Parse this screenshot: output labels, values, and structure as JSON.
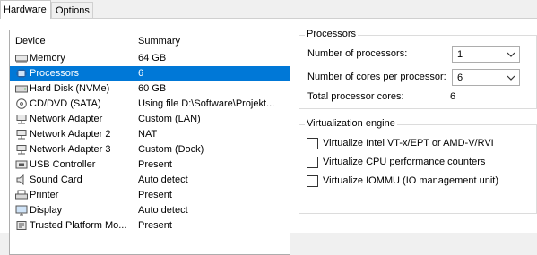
{
  "tabs": [
    {
      "label": "Hardware",
      "active": true
    },
    {
      "label": "Options",
      "active": false
    }
  ],
  "device_list": {
    "columns": [
      "Device",
      "Summary"
    ],
    "rows": [
      {
        "icon": "memory-icon",
        "device": "Memory",
        "summary": "64 GB",
        "selected": false
      },
      {
        "icon": "processor-icon",
        "device": "Processors",
        "summary": "6",
        "selected": true
      },
      {
        "icon": "hard-disk-icon",
        "device": "Hard Disk (NVMe)",
        "summary": "60 GB",
        "selected": false
      },
      {
        "icon": "cd-dvd-icon",
        "device": "CD/DVD (SATA)",
        "summary": "Using file D:\\Software\\Projekt...",
        "selected": false
      },
      {
        "icon": "network-adapter-icon",
        "device": "Network Adapter",
        "summary": "Custom (LAN)",
        "selected": false
      },
      {
        "icon": "network-adapter-icon",
        "device": "Network Adapter 2",
        "summary": "NAT",
        "selected": false
      },
      {
        "icon": "network-adapter-icon",
        "device": "Network Adapter 3",
        "summary": "Custom (Dock)",
        "selected": false
      },
      {
        "icon": "usb-controller-icon",
        "device": "USB Controller",
        "summary": "Present",
        "selected": false
      },
      {
        "icon": "sound-card-icon",
        "device": "Sound Card",
        "summary": "Auto detect",
        "selected": false
      },
      {
        "icon": "printer-icon",
        "device": "Printer",
        "summary": "Present",
        "selected": false
      },
      {
        "icon": "display-icon",
        "device": "Display",
        "summary": "Auto detect",
        "selected": false
      },
      {
        "icon": "tpm-icon",
        "device": "Trusted Platform Mo...",
        "summary": "Present",
        "selected": false
      }
    ]
  },
  "processors": {
    "title": "Processors",
    "num_processors_label": "Number of processors:",
    "num_processors_value": "1",
    "cores_label": "Number of cores per processor:",
    "cores_value": "6",
    "total_label": "Total processor cores:",
    "total_value": "6"
  },
  "virtualization": {
    "title": "Virtualization engine",
    "options": [
      {
        "label": "Virtualize Intel VT-x/EPT or AMD-V/RVI",
        "checked": false
      },
      {
        "label": "Virtualize CPU performance counters",
        "checked": false
      },
      {
        "label": "Virtualize IOMMU (IO management unit)",
        "checked": false
      }
    ]
  },
  "colors": {
    "selection": "#0078d7",
    "panel_bg": "#ffffff",
    "window_bg": "#f0f0f0"
  }
}
